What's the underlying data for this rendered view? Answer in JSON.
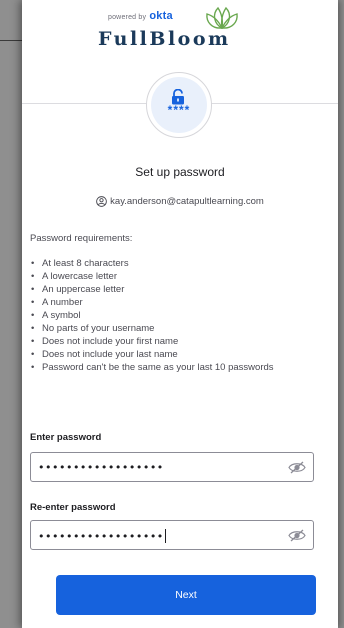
{
  "header": {
    "powered_by": "powered by",
    "okta": "okta",
    "brand_name": "FullBloom"
  },
  "factor": {
    "icon": "lock-open-icon",
    "masked": "****"
  },
  "title": "Set up password",
  "identity": {
    "icon": "user-circle-icon",
    "email": "kay.anderson@catapultlearning.com"
  },
  "requirements": {
    "heading": "Password requirements:",
    "items": [
      "At least 8 characters",
      "A lowercase letter",
      "An uppercase letter",
      "A number",
      "A symbol",
      "No parts of your username",
      "Does not include your first name",
      "Does not include your last name",
      "Password can't be the same as your last 10 passwords"
    ]
  },
  "password": {
    "label": "Enter password",
    "value": "••••••••••••••••••",
    "toggle_icon": "eye-slash-icon"
  },
  "confirm": {
    "label": "Re-enter password",
    "value": "••••••••••••••••••",
    "toggle_icon": "eye-slash-icon"
  },
  "actions": {
    "next_label": "Next"
  },
  "colors": {
    "accent": "#1662dd",
    "brand": "#1b3a5a",
    "leaf": "#6aa84f"
  }
}
